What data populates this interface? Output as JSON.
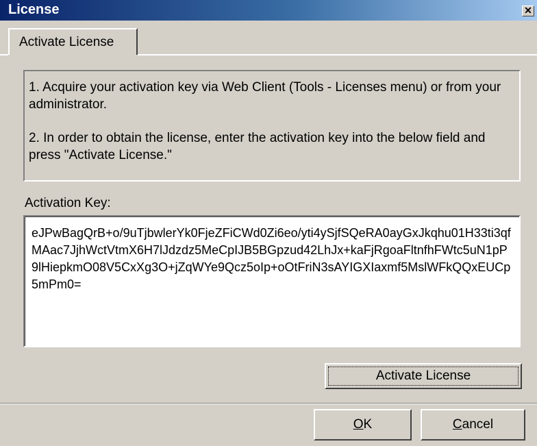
{
  "window": {
    "title": "License",
    "close_glyph": "✕"
  },
  "tabs": [
    {
      "label": "Activate License",
      "active": true
    }
  ],
  "instructions": {
    "step1": "1. Acquire your activation key via Web Client (Tools - Licenses menu) or from your administrator.",
    "step2": "2. In order to obtain the license, enter the activation key into the below field and press \"Activate License.\""
  },
  "activation": {
    "label": "Activation Key:",
    "value": "eJPwBagQrB+o/9uTjbwlerYk0FjeZFiCWd0Zi6eo/yti4ySjfSQeRA0ayGxJkqhu01H33ti3qfMAac7JjhWctVtmX6H7lJdzdz5MeCpIJB5BGpzud42LhJx+kaFjRgoaFltnfhFWtc5uN1pP9lHiepkmO08V5CxXg3O+jZqWYe9Qcz5oIp+oOtFriN3sAYIGXIaxmf5MslWFkQQxEUCp5mPm0=",
    "button_label": "Activate License"
  },
  "footer": {
    "ok_first": "O",
    "ok_rest": "K",
    "cancel_first": "C",
    "cancel_rest": "ancel"
  }
}
